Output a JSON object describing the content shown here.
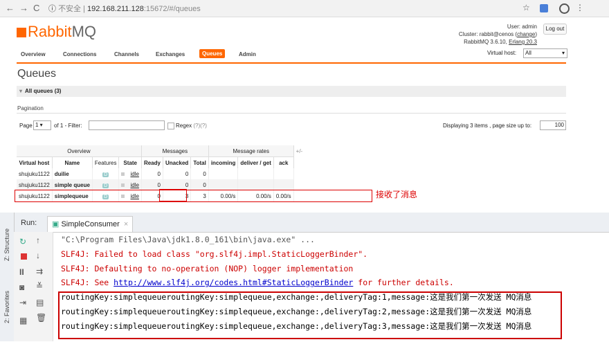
{
  "browser": {
    "back_icon": "←",
    "forward_icon": "→",
    "reload_icon": "C",
    "info_icon": "ⓘ",
    "insecure": "不安全",
    "url_host": "192.168.211.128",
    "url_rest": ":15672/#/queues",
    "star_icon": "☆",
    "menu_icon": "⋮"
  },
  "app": {
    "logo_main": "Rabbit",
    "logo_mq": "MQ",
    "user_line": "User: admin",
    "cluster_prefix": "Cluster: ",
    "cluster_link": "rabbit@cenos",
    "cluster_change": "change",
    "version_line": "RabbitMQ 3.6.10, ",
    "erlang_link": "Erlang 20.3",
    "logout": "Log out",
    "tabs": [
      "Overview",
      "Connections",
      "Channels",
      "Exchanges",
      "Queues",
      "Admin"
    ],
    "active_tab": "Queues",
    "vhost_label": "Virtual host:",
    "vhost_value": "All"
  },
  "queues": {
    "title": "Queues",
    "section": "All queues (3)",
    "pagination_label": "Pagination",
    "page_label": "Page",
    "page_value": "1",
    "of_label": "of 1  - Filter:",
    "regex_label": "Regex",
    "regex_help": "(?)(?)",
    "displaying": "Displaying 3 items , page size up to:",
    "page_size": "100",
    "groups": {
      "overview": "Overview",
      "messages": "Messages",
      "rates": "Message rates",
      "plusminus": "+/-"
    },
    "columns": [
      "Virtual host",
      "Name",
      "Features",
      "State",
      "Ready",
      "Unacked",
      "Total",
      "incoming",
      "deliver / get",
      "ack"
    ],
    "rows": [
      {
        "vhost": "shujuku1122",
        "name": "duilie",
        "feature": "D",
        "state": "idle",
        "ready": "0",
        "unacked": "0",
        "total": "0",
        "incoming": "",
        "deliver": "",
        "ack": ""
      },
      {
        "vhost": "shujuku1122",
        "name": "simple queue",
        "feature": "D",
        "state": "idle",
        "ready": "0",
        "unacked": "0",
        "total": "0",
        "incoming": "",
        "deliver": "",
        "ack": ""
      },
      {
        "vhost": "shujuku1122",
        "name": "simplequeue",
        "feature": "D",
        "state": "idle",
        "ready": "0",
        "unacked": "3",
        "total": "3",
        "incoming": "0.00/s",
        "deliver": "0.00/s",
        "ack": "0.00/s"
      }
    ],
    "annotation": "接收了消息"
  },
  "ide": {
    "run_label": "Run:",
    "run_tab": "SimpleConsumer",
    "left_labels": [
      "Z: Structure",
      "2: Favorites"
    ],
    "lines": [
      {
        "kind": "cmd",
        "text": "\"C:\\Program Files\\Java\\jdk1.8.0_161\\bin\\java.exe\" ..."
      },
      {
        "kind": "err",
        "text": "SLF4J: Failed to load class \"org.slf4j.impl.StaticLoggerBinder\"."
      },
      {
        "kind": "err",
        "text": "SLF4J: Defaulting to no-operation (NOP) logger implementation"
      },
      {
        "kind": "err_link",
        "prefix": "SLF4J: See ",
        "link": "http://www.slf4j.org/codes.html#StaticLoggerBinder",
        "suffix": " for further details."
      },
      {
        "kind": "out",
        "text": "routingKey:simplequeueroutingKey:simplequeue,exchange:,deliveryTag:1,message:这是我们第一次发送 MQ消息"
      },
      {
        "kind": "out",
        "text": "routingKey:simplequeueroutingKey:simplequeue,exchange:,deliveryTag:2,message:这是我们第一次发送 MQ消息"
      },
      {
        "kind": "out",
        "text": "routingKey:simplequeueroutingKey:simplequeue,exchange:,deliveryTag:3,message:这是我们第一次发送 MQ消息"
      }
    ]
  }
}
